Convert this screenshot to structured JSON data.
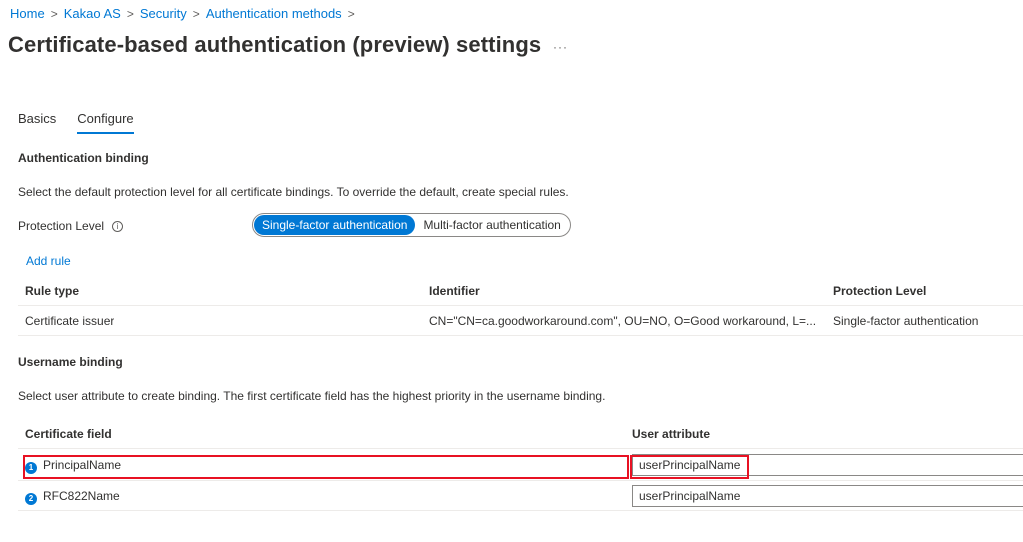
{
  "breadcrumb": {
    "items": [
      "Home",
      "Kakao AS",
      "Security",
      "Authentication methods"
    ],
    "separator": ">"
  },
  "page": {
    "title": "Certificate-based authentication (preview) settings",
    "more_label": "···"
  },
  "tabs": [
    {
      "label": "Basics",
      "active": false
    },
    {
      "label": "Configure",
      "active": true
    }
  ],
  "auth_binding": {
    "title": "Authentication binding",
    "description": "Select the default protection level for all certificate bindings. To override the default, create special rules.",
    "protection_label": "Protection Level",
    "info_glyph": "i",
    "options": [
      "Single-factor authentication",
      "Multi-factor authentication"
    ],
    "selected": "Single-factor authentication",
    "add_rule": "Add rule",
    "table": {
      "headers": [
        "Rule type",
        "Identifier",
        "Protection Level"
      ],
      "rows": [
        {
          "rule_type": "Certificate issuer",
          "identifier": "CN=\"CN=ca.goodworkaround.com\", OU=NO, O=Good workaround, L=...",
          "level": "Single-factor authentication"
        }
      ]
    }
  },
  "username_binding": {
    "title": "Username binding",
    "description": "Select user attribute to create binding. The first certificate field has the highest priority in the username binding.",
    "table": {
      "headers": [
        "Certificate field",
        "User attribute"
      ],
      "rows": [
        {
          "num": "1",
          "field": "PrincipalName",
          "attribute": "userPrincipalName"
        },
        {
          "num": "2",
          "field": "RFC822Name",
          "attribute": "userPrincipalName"
        }
      ]
    }
  },
  "colors": {
    "accent": "#0078d4",
    "highlight": "#e81123",
    "text": "#323130"
  },
  "icons": [
    "info-icon",
    "more-icon",
    "chevron-right-icon",
    "number-badge-icon"
  ]
}
